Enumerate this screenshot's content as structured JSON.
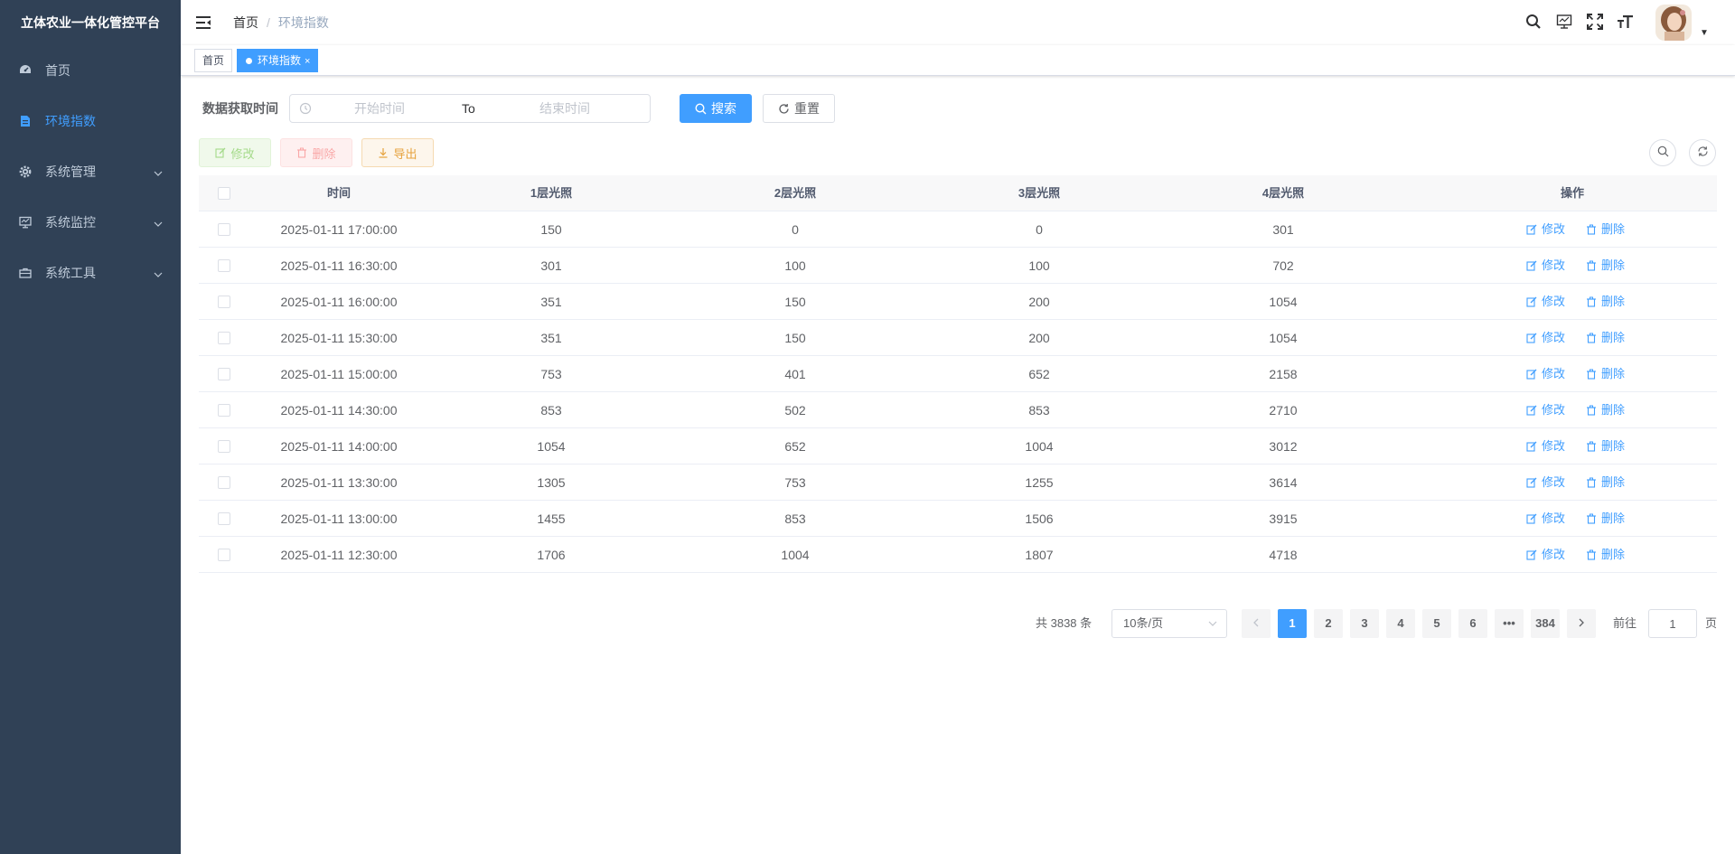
{
  "app": {
    "title": "立体农业一体化管控平台"
  },
  "sidebar": {
    "items": [
      {
        "label": "首页",
        "icon": "dashboard-icon",
        "active": false,
        "expandable": false
      },
      {
        "label": "环境指数",
        "icon": "document-icon",
        "active": true,
        "expandable": false
      },
      {
        "label": "系统管理",
        "icon": "gear-icon",
        "active": false,
        "expandable": true
      },
      {
        "label": "系统监控",
        "icon": "monitor-icon",
        "active": false,
        "expandable": true
      },
      {
        "label": "系统工具",
        "icon": "toolbox-icon",
        "active": false,
        "expandable": true
      }
    ]
  },
  "breadcrumb": {
    "home": "首页",
    "separator": "/",
    "current": "环境指数"
  },
  "tags": [
    {
      "label": "首页",
      "active": false
    },
    {
      "label": "环境指数",
      "active": true,
      "close": "×"
    }
  ],
  "search": {
    "label": "数据获取时间",
    "start_placeholder": "开始时间",
    "range_separator": "To",
    "end_placeholder": "结束时间",
    "search_label": "搜索",
    "reset_label": "重置"
  },
  "toolbar": {
    "edit_label": "修改",
    "delete_label": "删除",
    "export_label": "导出"
  },
  "table": {
    "headers": [
      "时间",
      "1层光照",
      "2层光照",
      "3层光照",
      "4层光照",
      "操作"
    ],
    "row_edit": "修改",
    "row_delete": "删除",
    "rows": [
      [
        "2025-01-11 17:00:00",
        "150",
        "0",
        "0",
        "301"
      ],
      [
        "2025-01-11 16:30:00",
        "301",
        "100",
        "100",
        "702"
      ],
      [
        "2025-01-11 16:00:00",
        "351",
        "150",
        "200",
        "1054"
      ],
      [
        "2025-01-11 15:30:00",
        "351",
        "150",
        "200",
        "1054"
      ],
      [
        "2025-01-11 15:00:00",
        "753",
        "401",
        "652",
        "2158"
      ],
      [
        "2025-01-11 14:30:00",
        "853",
        "502",
        "853",
        "2710"
      ],
      [
        "2025-01-11 14:00:00",
        "1054",
        "652",
        "1004",
        "3012"
      ],
      [
        "2025-01-11 13:30:00",
        "1305",
        "753",
        "1255",
        "3614"
      ],
      [
        "2025-01-11 13:00:00",
        "1455",
        "853",
        "1506",
        "3915"
      ],
      [
        "2025-01-11 12:30:00",
        "1706",
        "1004",
        "1807",
        "4718"
      ]
    ]
  },
  "pagination": {
    "total_text": "共 3838 条",
    "page_size": "10条/页",
    "pages": [
      "1",
      "2",
      "3",
      "4",
      "5",
      "6",
      "•••",
      "384"
    ],
    "current_page": "1",
    "goto_prefix": "前往",
    "goto_value": "1",
    "goto_suffix": "页"
  },
  "colors": {
    "sidebar_bg": "#304156",
    "accent": "#409eff",
    "sidebar_text": "#bfcbd9"
  }
}
